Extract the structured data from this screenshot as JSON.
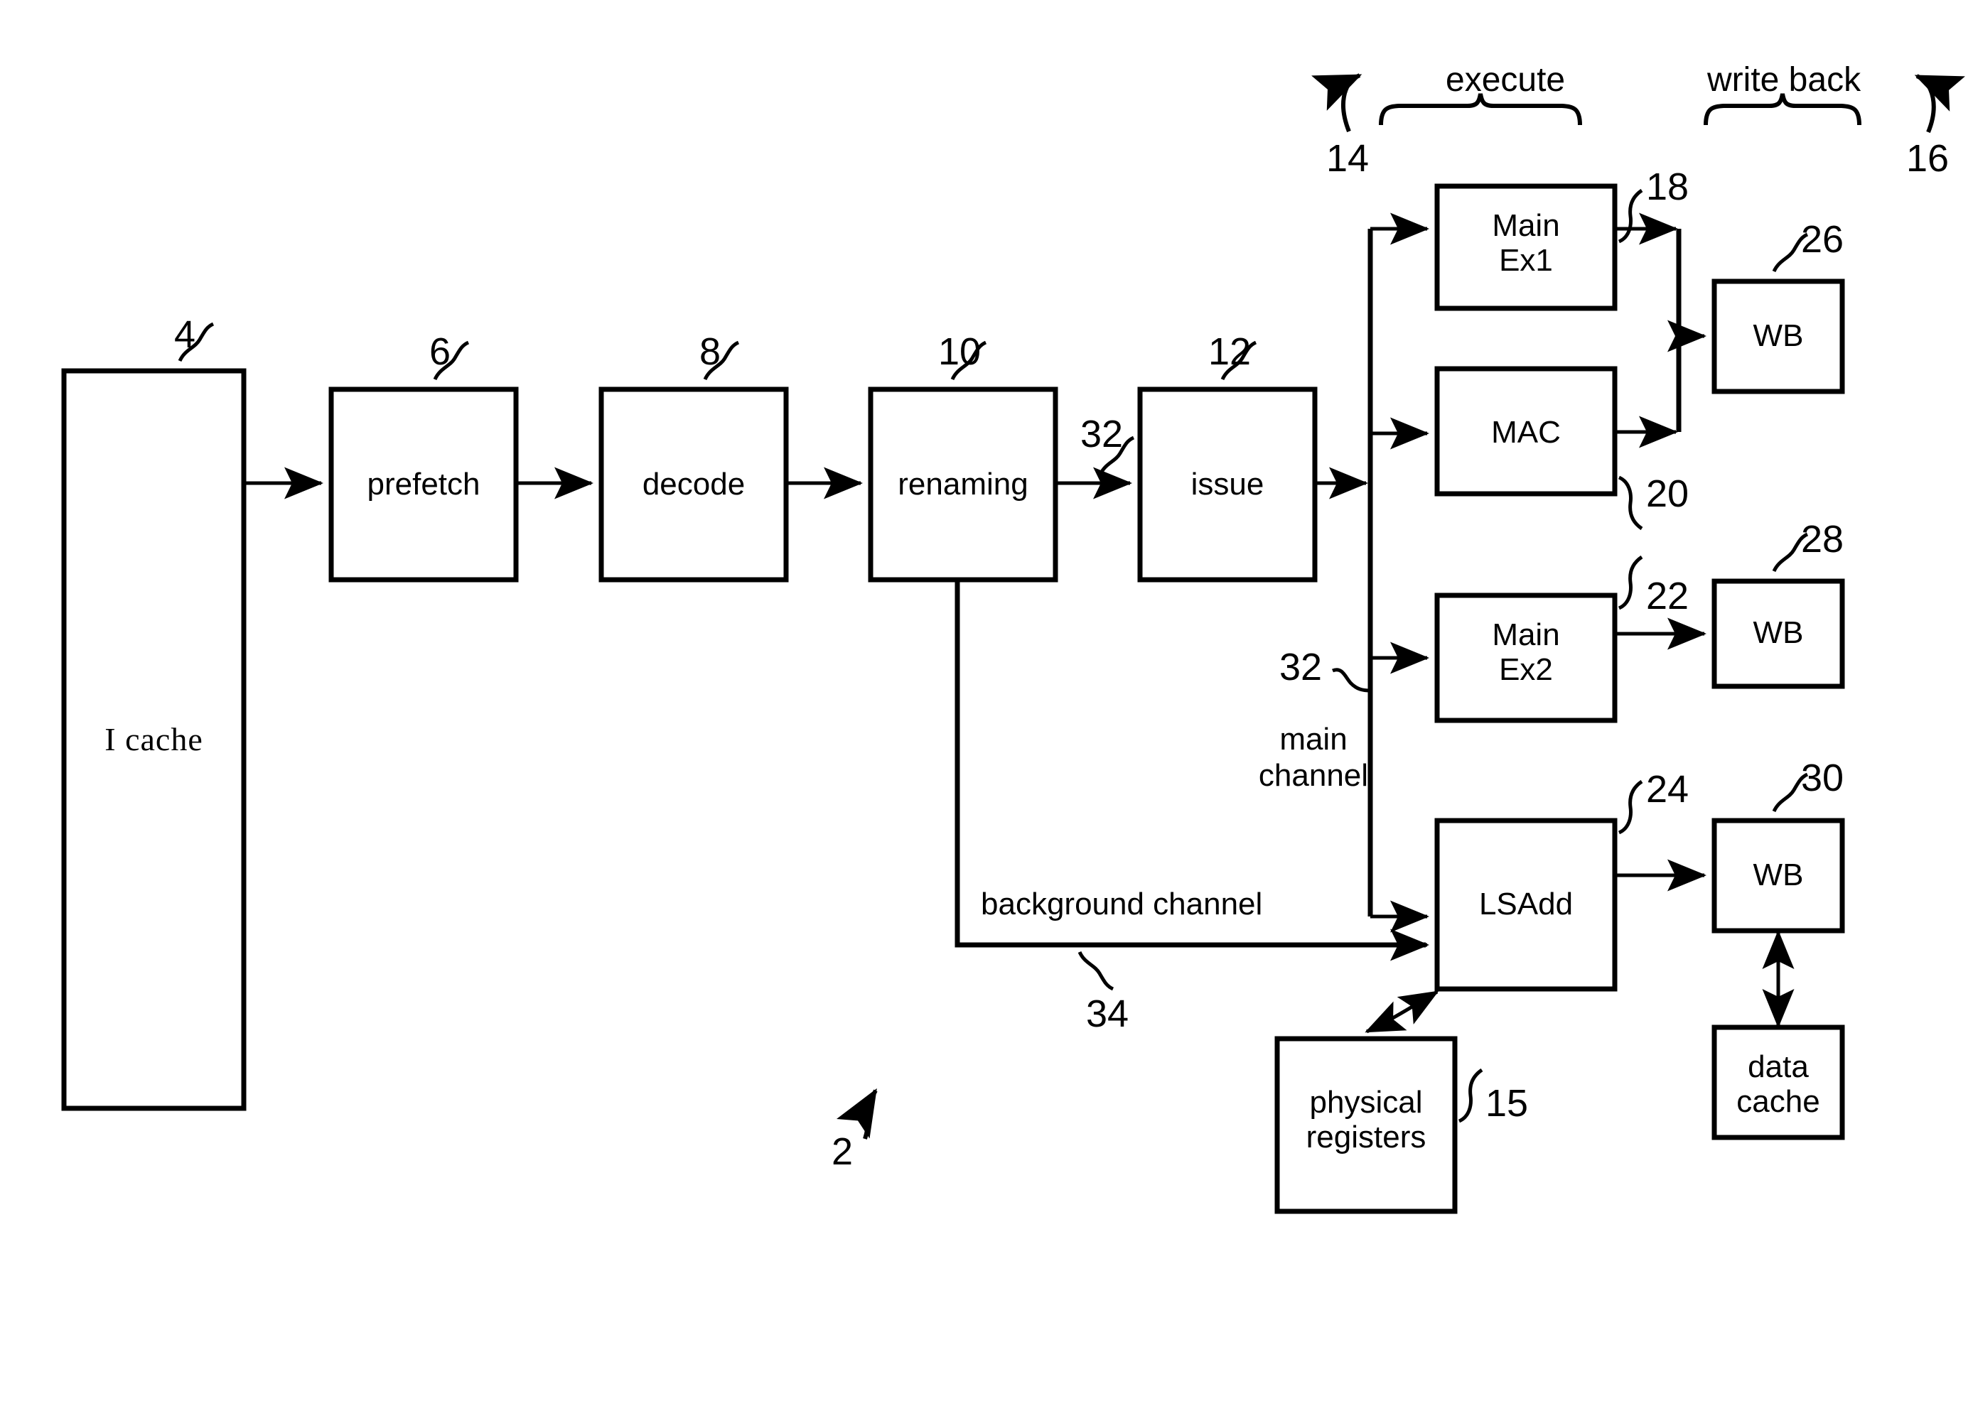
{
  "figure": {
    "title": "Processor pipeline block diagram",
    "figure_ref": "2",
    "stroke_color": "#000000",
    "background_color": "#ffffff"
  },
  "blocks": {
    "icache": {
      "label": "I cache",
      "ref": "4"
    },
    "prefetch": {
      "label": "prefetch",
      "ref": "6"
    },
    "decode": {
      "label": "decode",
      "ref": "8"
    },
    "renaming": {
      "label": "renaming",
      "ref": "10"
    },
    "issue": {
      "label": "issue",
      "ref": "12"
    },
    "mainex1": {
      "label": "Main\nEx1",
      "ref": "18"
    },
    "mac": {
      "label": "MAC",
      "ref": "20"
    },
    "mainex2": {
      "label": "Main\nEx2",
      "ref": "22"
    },
    "lsadd": {
      "label": "LSAdd",
      "ref": "24"
    },
    "wb1": {
      "label": "WB",
      "ref": "26"
    },
    "wb2": {
      "label": "WB",
      "ref": "28"
    },
    "wb3": {
      "label": "WB",
      "ref": "30"
    },
    "physregs": {
      "label": "physical\nregisters",
      "ref": "15"
    },
    "datacache": {
      "label": "data\ncache",
      "ref": ""
    }
  },
  "stages": {
    "execute": {
      "label": "execute",
      "ref": "14"
    },
    "write_back": {
      "label": "write back",
      "ref": "16"
    }
  },
  "channels": {
    "main": {
      "label": "main\nchannel",
      "ref": "32"
    },
    "background": {
      "label": "background channel",
      "ref": "34"
    },
    "issue_link": {
      "ref": "32"
    }
  }
}
